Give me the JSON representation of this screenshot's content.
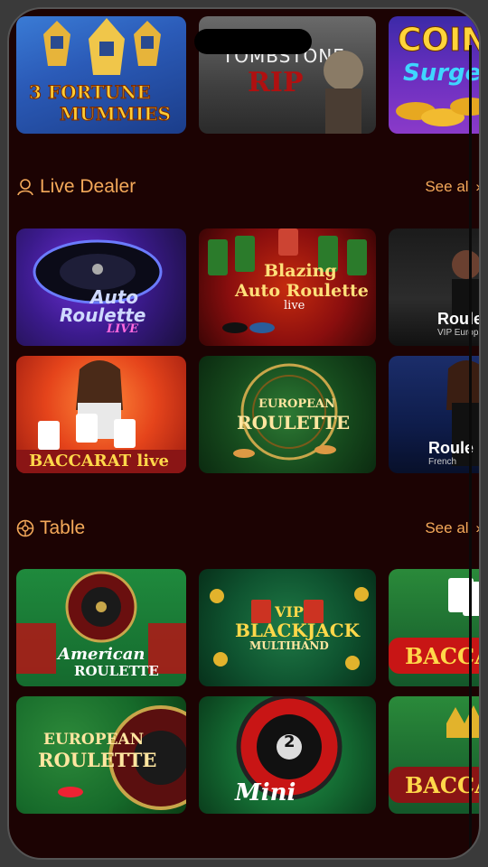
{
  "top_row": [
    {
      "title_line1": "3 FORTUNE",
      "title_line2": "MUMMIES"
    },
    {
      "title_line1": "TOMBSTONE",
      "title_line2": "RIP"
    },
    {
      "title_line1": "COIN",
      "title_line2": "Surge"
    }
  ],
  "live_dealer": {
    "title": "Live Dealer",
    "see_all": "See all",
    "icon": "user-icon",
    "row1": [
      {
        "line1": "Auto",
        "line2": "Roulette",
        "line3": "LIVE"
      },
      {
        "line1": "Blazing",
        "line2": "Auto Roulette",
        "line3": "live"
      },
      {
        "line1": "Roule",
        "line2": "VIP Europ"
      }
    ],
    "row2": [
      {
        "line1": "BACCARAT live"
      },
      {
        "line1": "EUROPEAN",
        "line2": "ROULETTE"
      },
      {
        "line1": "Roule",
        "line2": "French"
      }
    ]
  },
  "table": {
    "title": "Table",
    "see_all": "See all",
    "icon": "roulette-wheel-icon",
    "row1": [
      {
        "line1": "American",
        "line2": "ROULETTE"
      },
      {
        "line1": "VIP",
        "line2": "BLACKJACK",
        "line3": "MULTIHAND"
      },
      {
        "line1": "BACCA"
      }
    ],
    "row2": [
      {
        "line1": "EUROPEAN",
        "line2": "ROULETTE"
      },
      {
        "line1": "Mini",
        "line2": "2"
      },
      {
        "line1": "BACCA"
      }
    ]
  },
  "colors": {
    "background": "#1c0303",
    "accent": "#f4a95a"
  }
}
